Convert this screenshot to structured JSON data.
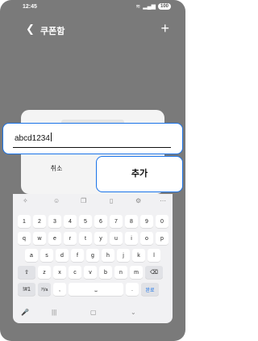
{
  "status": {
    "time": "12:45",
    "battery": "100"
  },
  "appbar": {
    "title": "쿠폰함",
    "back_icon": "chevron-left-icon",
    "add_icon": "plus-icon"
  },
  "dialog": {
    "input_value": "abcd1234",
    "cancel_label": "취소",
    "add_label": "추가"
  },
  "keyboard": {
    "row1": [
      "1",
      "2",
      "3",
      "4",
      "5",
      "6",
      "7",
      "8",
      "9",
      "0"
    ],
    "row2": [
      "q",
      "w",
      "e",
      "r",
      "t",
      "y",
      "u",
      "i",
      "o",
      "p"
    ],
    "row3": [
      "a",
      "s",
      "d",
      "f",
      "g",
      "h",
      "j",
      "k",
      "l"
    ],
    "row4": [
      "z",
      "x",
      "c",
      "v",
      "b",
      "n",
      "m"
    ],
    "symbols_key": "!#1",
    "korean_key": "가/a",
    "comma": ",",
    "period": ".",
    "done_key": "완료"
  },
  "colors": {
    "accent": "#1a73e8",
    "scrim": "#7a7a7a"
  }
}
